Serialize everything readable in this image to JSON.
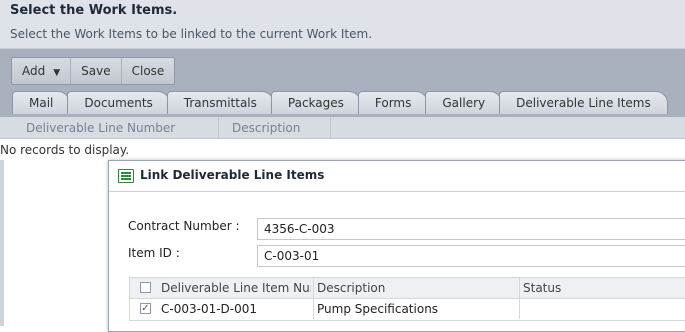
{
  "header": {
    "title": "Select the Work Items.",
    "subtitle": "Select the Work Items to be linked to the current Work Item."
  },
  "toolbar": {
    "add_label": "Add",
    "save_label": "Save",
    "close_label": "Close"
  },
  "tabs": [
    {
      "label": "Mail"
    },
    {
      "label": "Documents"
    },
    {
      "label": "Transmittals"
    },
    {
      "label": "Packages"
    },
    {
      "label": "Forms"
    },
    {
      "label": "Gallery"
    },
    {
      "label": "Deliverable Line Items"
    }
  ],
  "grid": {
    "columns": [
      "Deliverable Line Number",
      "Description"
    ],
    "empty_message": "No records to display."
  },
  "dialog": {
    "title": "Link Deliverable Line Items",
    "contract_label": "Contract Number :",
    "contract_value": "4356-C-003",
    "item_label": "Item ID :",
    "item_value": "C-003-01",
    "table": {
      "columns": [
        "Deliverable Line Item Numb",
        "Description",
        "Status"
      ],
      "rows": [
        {
          "checked": true,
          "number": "C-003-01-D-001",
          "description": "Pump Specifications",
          "status": ""
        }
      ]
    }
  },
  "icons": {
    "dialog_icon": "list-window-icon",
    "add_dropdown": "chevron-down-icon",
    "checkbox_checked": "checkmark-icon"
  },
  "colors": {
    "header_bg": "#dfe2e8",
    "toolbar_bg": "#a9b1bf",
    "dialog_icon": "#2e8b3a"
  }
}
